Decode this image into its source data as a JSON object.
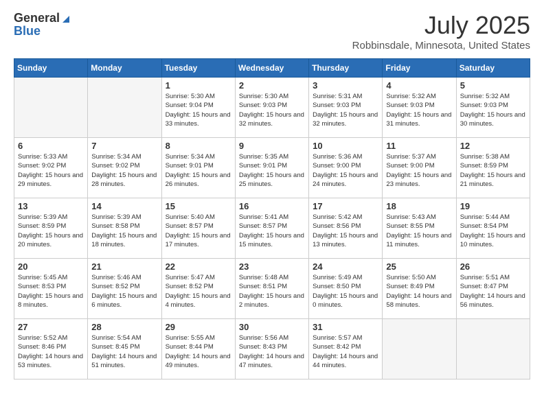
{
  "header": {
    "logo_general": "General",
    "logo_blue": "Blue",
    "month_year": "July 2025",
    "location": "Robbinsdale, Minnesota, United States"
  },
  "weekdays": [
    "Sunday",
    "Monday",
    "Tuesday",
    "Wednesday",
    "Thursday",
    "Friday",
    "Saturday"
  ],
  "weeks": [
    [
      {
        "day": "",
        "empty": true
      },
      {
        "day": "",
        "empty": true
      },
      {
        "day": "1",
        "sunrise": "Sunrise: 5:30 AM",
        "sunset": "Sunset: 9:04 PM",
        "daylight": "Daylight: 15 hours and 33 minutes."
      },
      {
        "day": "2",
        "sunrise": "Sunrise: 5:30 AM",
        "sunset": "Sunset: 9:03 PM",
        "daylight": "Daylight: 15 hours and 32 minutes."
      },
      {
        "day": "3",
        "sunrise": "Sunrise: 5:31 AM",
        "sunset": "Sunset: 9:03 PM",
        "daylight": "Daylight: 15 hours and 32 minutes."
      },
      {
        "day": "4",
        "sunrise": "Sunrise: 5:32 AM",
        "sunset": "Sunset: 9:03 PM",
        "daylight": "Daylight: 15 hours and 31 minutes."
      },
      {
        "day": "5",
        "sunrise": "Sunrise: 5:32 AM",
        "sunset": "Sunset: 9:03 PM",
        "daylight": "Daylight: 15 hours and 30 minutes."
      }
    ],
    [
      {
        "day": "6",
        "sunrise": "Sunrise: 5:33 AM",
        "sunset": "Sunset: 9:02 PM",
        "daylight": "Daylight: 15 hours and 29 minutes."
      },
      {
        "day": "7",
        "sunrise": "Sunrise: 5:34 AM",
        "sunset": "Sunset: 9:02 PM",
        "daylight": "Daylight: 15 hours and 28 minutes."
      },
      {
        "day": "8",
        "sunrise": "Sunrise: 5:34 AM",
        "sunset": "Sunset: 9:01 PM",
        "daylight": "Daylight: 15 hours and 26 minutes."
      },
      {
        "day": "9",
        "sunrise": "Sunrise: 5:35 AM",
        "sunset": "Sunset: 9:01 PM",
        "daylight": "Daylight: 15 hours and 25 minutes."
      },
      {
        "day": "10",
        "sunrise": "Sunrise: 5:36 AM",
        "sunset": "Sunset: 9:00 PM",
        "daylight": "Daylight: 15 hours and 24 minutes."
      },
      {
        "day": "11",
        "sunrise": "Sunrise: 5:37 AM",
        "sunset": "Sunset: 9:00 PM",
        "daylight": "Daylight: 15 hours and 23 minutes."
      },
      {
        "day": "12",
        "sunrise": "Sunrise: 5:38 AM",
        "sunset": "Sunset: 8:59 PM",
        "daylight": "Daylight: 15 hours and 21 minutes."
      }
    ],
    [
      {
        "day": "13",
        "sunrise": "Sunrise: 5:39 AM",
        "sunset": "Sunset: 8:59 PM",
        "daylight": "Daylight: 15 hours and 20 minutes."
      },
      {
        "day": "14",
        "sunrise": "Sunrise: 5:39 AM",
        "sunset": "Sunset: 8:58 PM",
        "daylight": "Daylight: 15 hours and 18 minutes."
      },
      {
        "day": "15",
        "sunrise": "Sunrise: 5:40 AM",
        "sunset": "Sunset: 8:57 PM",
        "daylight": "Daylight: 15 hours and 17 minutes."
      },
      {
        "day": "16",
        "sunrise": "Sunrise: 5:41 AM",
        "sunset": "Sunset: 8:57 PM",
        "daylight": "Daylight: 15 hours and 15 minutes."
      },
      {
        "day": "17",
        "sunrise": "Sunrise: 5:42 AM",
        "sunset": "Sunset: 8:56 PM",
        "daylight": "Daylight: 15 hours and 13 minutes."
      },
      {
        "day": "18",
        "sunrise": "Sunrise: 5:43 AM",
        "sunset": "Sunset: 8:55 PM",
        "daylight": "Daylight: 15 hours and 11 minutes."
      },
      {
        "day": "19",
        "sunrise": "Sunrise: 5:44 AM",
        "sunset": "Sunset: 8:54 PM",
        "daylight": "Daylight: 15 hours and 10 minutes."
      }
    ],
    [
      {
        "day": "20",
        "sunrise": "Sunrise: 5:45 AM",
        "sunset": "Sunset: 8:53 PM",
        "daylight": "Daylight: 15 hours and 8 minutes."
      },
      {
        "day": "21",
        "sunrise": "Sunrise: 5:46 AM",
        "sunset": "Sunset: 8:52 PM",
        "daylight": "Daylight: 15 hours and 6 minutes."
      },
      {
        "day": "22",
        "sunrise": "Sunrise: 5:47 AM",
        "sunset": "Sunset: 8:52 PM",
        "daylight": "Daylight: 15 hours and 4 minutes."
      },
      {
        "day": "23",
        "sunrise": "Sunrise: 5:48 AM",
        "sunset": "Sunset: 8:51 PM",
        "daylight": "Daylight: 15 hours and 2 minutes."
      },
      {
        "day": "24",
        "sunrise": "Sunrise: 5:49 AM",
        "sunset": "Sunset: 8:50 PM",
        "daylight": "Daylight: 15 hours and 0 minutes."
      },
      {
        "day": "25",
        "sunrise": "Sunrise: 5:50 AM",
        "sunset": "Sunset: 8:49 PM",
        "daylight": "Daylight: 14 hours and 58 minutes."
      },
      {
        "day": "26",
        "sunrise": "Sunrise: 5:51 AM",
        "sunset": "Sunset: 8:47 PM",
        "daylight": "Daylight: 14 hours and 56 minutes."
      }
    ],
    [
      {
        "day": "27",
        "sunrise": "Sunrise: 5:52 AM",
        "sunset": "Sunset: 8:46 PM",
        "daylight": "Daylight: 14 hours and 53 minutes."
      },
      {
        "day": "28",
        "sunrise": "Sunrise: 5:54 AM",
        "sunset": "Sunset: 8:45 PM",
        "daylight": "Daylight: 14 hours and 51 minutes."
      },
      {
        "day": "29",
        "sunrise": "Sunrise: 5:55 AM",
        "sunset": "Sunset: 8:44 PM",
        "daylight": "Daylight: 14 hours and 49 minutes."
      },
      {
        "day": "30",
        "sunrise": "Sunrise: 5:56 AM",
        "sunset": "Sunset: 8:43 PM",
        "daylight": "Daylight: 14 hours and 47 minutes."
      },
      {
        "day": "31",
        "sunrise": "Sunrise: 5:57 AM",
        "sunset": "Sunset: 8:42 PM",
        "daylight": "Daylight: 14 hours and 44 minutes."
      },
      {
        "day": "",
        "empty": true
      },
      {
        "day": "",
        "empty": true
      }
    ]
  ]
}
